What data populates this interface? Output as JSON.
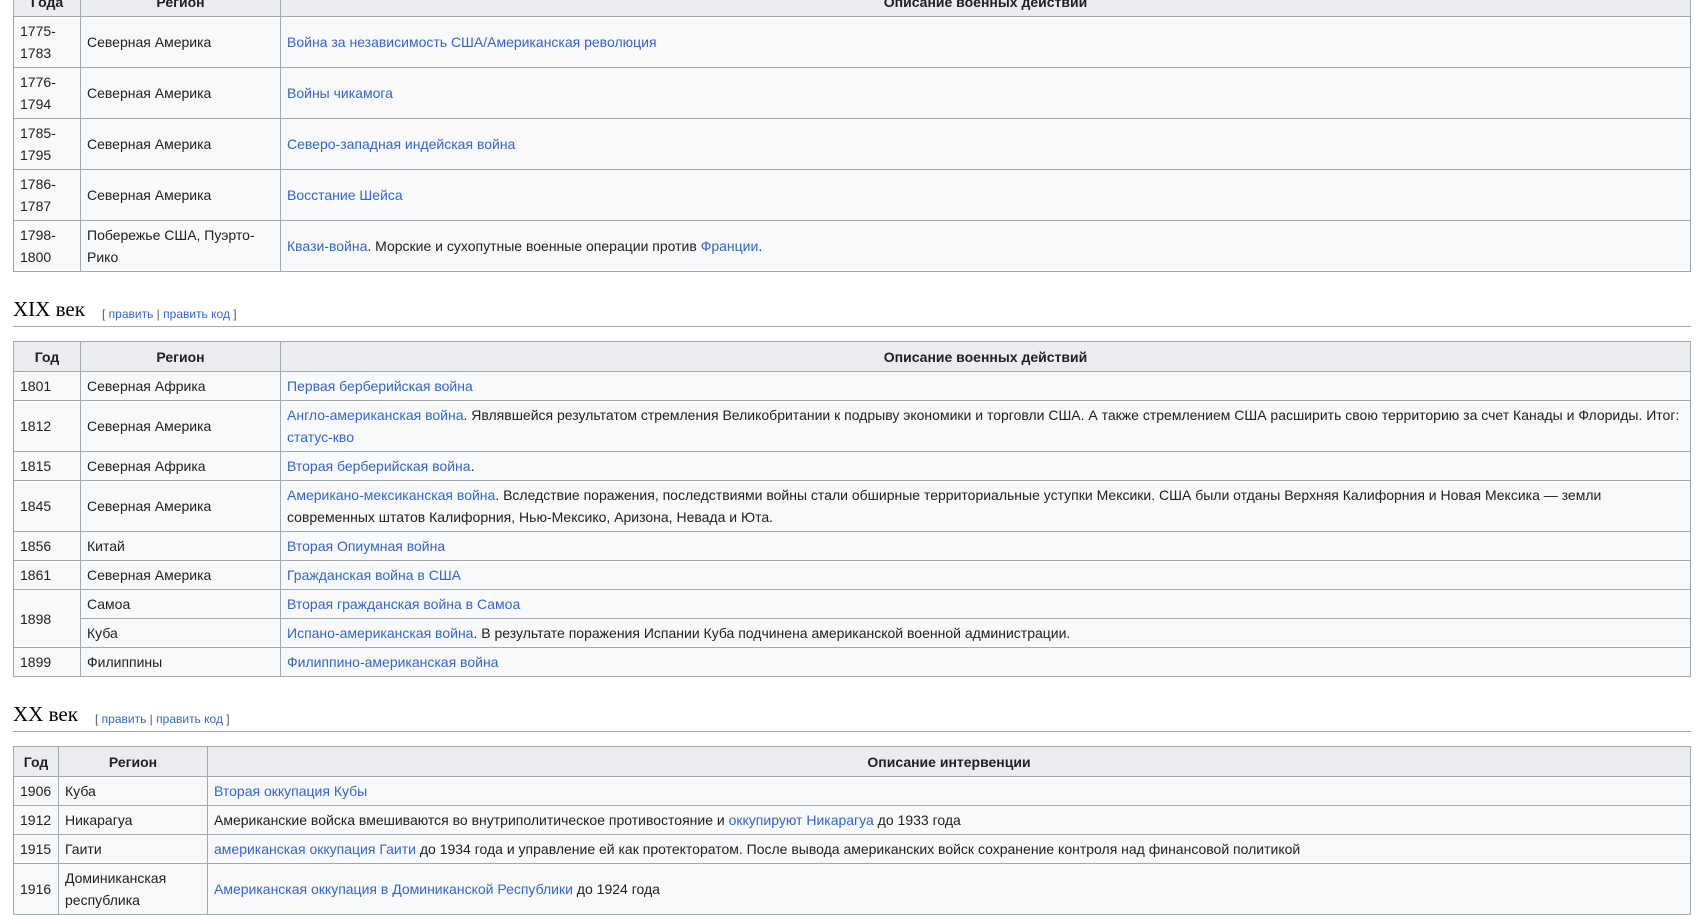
{
  "colors": {
    "link": "#3366cc",
    "text": "#202122",
    "header_bg": "#eaecf0",
    "border": "#a2a9b1",
    "cell_bg": "#f8f9fa"
  },
  "table18": {
    "headers": [
      "Года",
      "Регион",
      "Описание военных действий"
    ],
    "rows": [
      {
        "year": "1775-1783",
        "region": "Северная Америка",
        "link": "Война за независимость США/Американская революция"
      },
      {
        "year": "1776-1794",
        "region": "Северная Америка",
        "link": "Войны чикамога"
      },
      {
        "year": "1785-1795",
        "region": "Северная Америка",
        "link": "Северо-западная индейская война"
      },
      {
        "year": "1786-1787",
        "region": "Северная Америка",
        "link": "Восстание Шейса"
      },
      {
        "year": "1798-1800",
        "region": "Побережье США, Пуэрто-Рико",
        "link": "Квази-война",
        "text": ". Морские и сухопутные военные операции против ",
        "link2": "Франции",
        "text2": "."
      }
    ]
  },
  "section19": {
    "title": "XIX век",
    "edit_open": "[ ",
    "edit": "править",
    "sep": " | ",
    "edit_code": "править код",
    "edit_close": " ]"
  },
  "table19": {
    "headers": [
      "Год",
      "Регион",
      "Описание военных действий"
    ],
    "rows": [
      {
        "year": "1801",
        "region": "Северная Африка",
        "link": "Первая берберийская война"
      },
      {
        "year": "1812",
        "region": "Северная Америка",
        "link": "Англо-американская война",
        "text": ". Являвшейся результатом стремления Великобритании к подрыву экономики и торговли США. А также стремлением США расширить свою территорию за счет Канады и Флориды. Итог: ",
        "link2": "статус-кво"
      },
      {
        "year": "1815",
        "region": "Северная Африка",
        "link": "Вторая берберийская война",
        "text": "."
      },
      {
        "year": "1845",
        "region": "Северная Америка",
        "link": "Американо-мексиканская война",
        "text": ". Вследствие поражения, последствиями войны стали обширные территориальные уступки Мексики. США были отданы Верхняя Калифорния и Новая Мексика — земли современных штатов Калифорния, Нью-Мексико, Аризона, Невада и Юта."
      },
      {
        "year": "1856",
        "region": "Китай",
        "link": "Вторая Опиумная война"
      },
      {
        "year": "1861",
        "region": "Северная Америка",
        "link": "Гражданская война в США"
      },
      {
        "year": "1898",
        "region": "Самоа",
        "link": "Вторая гражданская война в Самоа"
      },
      {
        "region": "Куба",
        "link": "Испано-американская война",
        "text": ". В результате поражения Испании Куба подчинена американской военной администрации."
      },
      {
        "year": "1899",
        "region": "Филиппины",
        "link": "Филиппино-американская война"
      }
    ]
  },
  "section20": {
    "title": "XX век",
    "edit_open": "[ ",
    "edit": "править",
    "sep": " | ",
    "edit_code": "править код",
    "edit_close": " ]"
  },
  "table20": {
    "headers": [
      "Год",
      "Регион",
      "Описание интервенции"
    ],
    "rows": [
      {
        "year": "1906",
        "region": "Куба",
        "link": "Вторая оккупация Кубы"
      },
      {
        "year": "1912",
        "region": "Никарагуа",
        "pre": "Американские войска вмешиваются во внутриполитическое противостояние и ",
        "link": "оккупируют Никарагуа",
        "text": " до 1933 года"
      },
      {
        "year": "1915",
        "region": "Гаити",
        "link": "американская оккупация Гаити",
        "text": " до 1934 года и управление ей как протекторатом. После вывода американских войск сохранение контроля над финансовой политикой"
      },
      {
        "year": "1916",
        "region": "Доминиканская республика",
        "link": "Американская оккупация в Доминиканской Республики",
        "text": " до 1924 года"
      }
    ]
  }
}
